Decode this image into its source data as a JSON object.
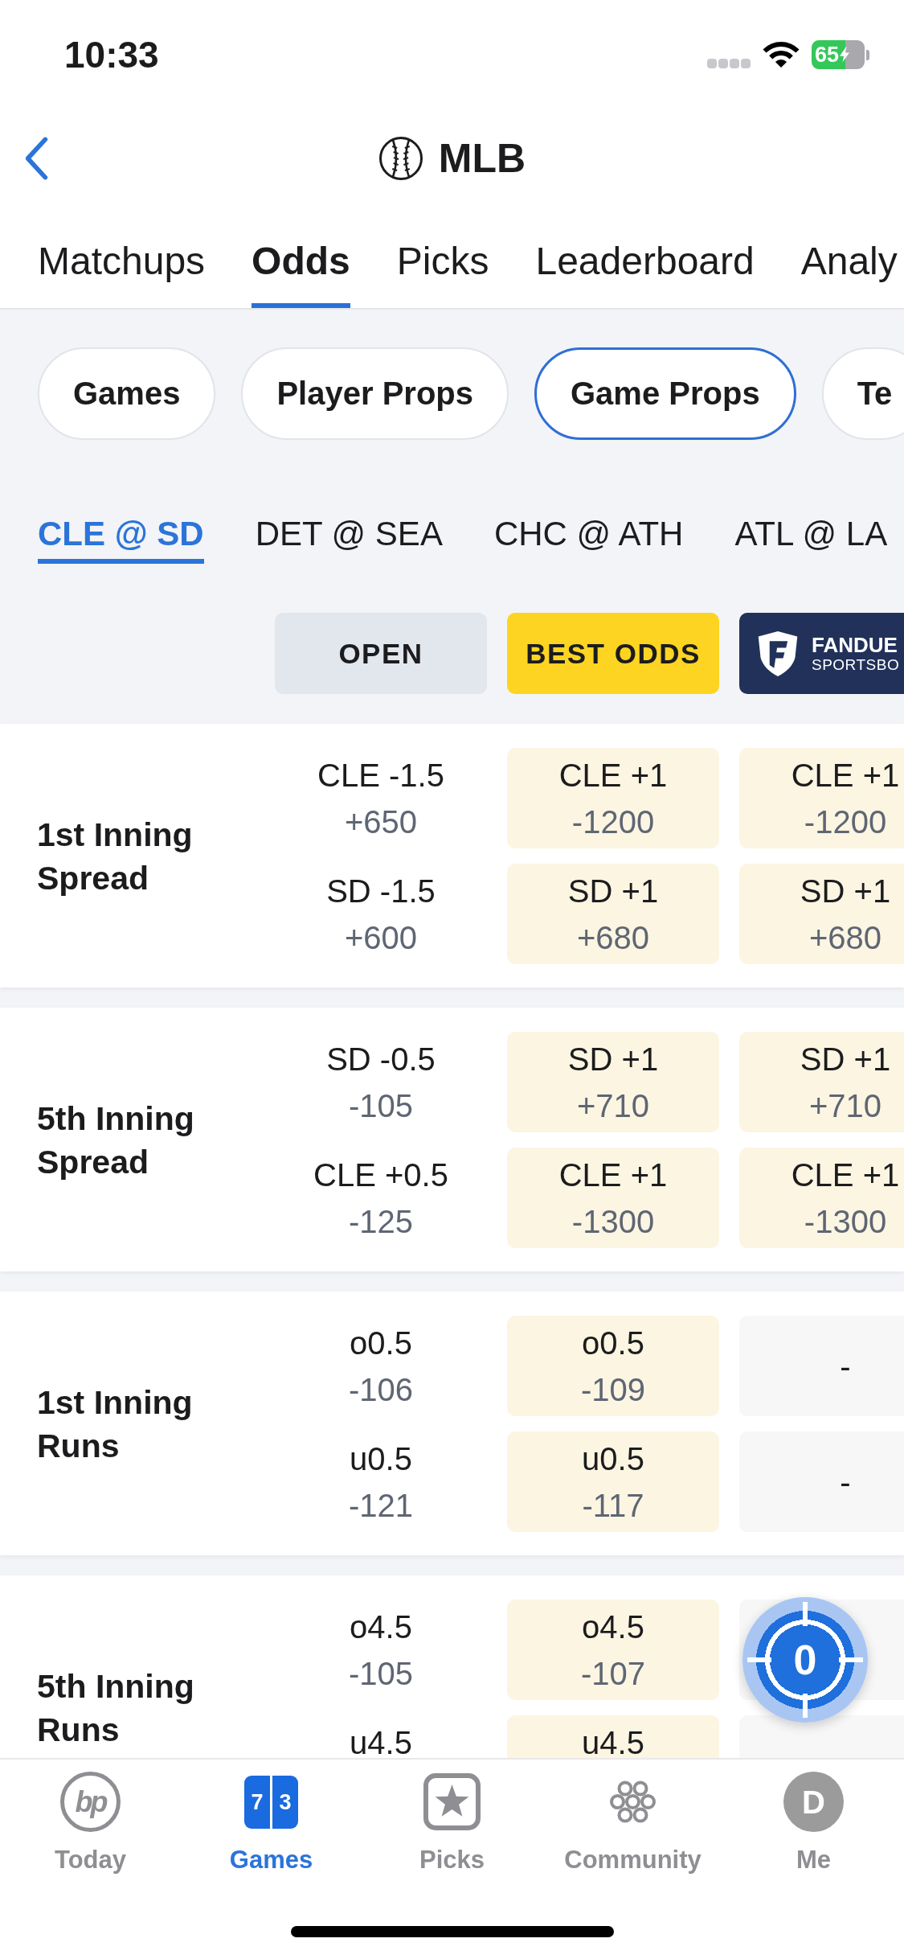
{
  "status_bar": {
    "time": "10:33",
    "battery": "65",
    "charging": true
  },
  "header": {
    "title": "MLB"
  },
  "tabs": [
    {
      "label": "Matchups",
      "selected": false
    },
    {
      "label": "Odds",
      "selected": true
    },
    {
      "label": "Picks",
      "selected": false
    },
    {
      "label": "Leaderboard",
      "selected": false
    },
    {
      "label": "Analy",
      "selected": false
    }
  ],
  "filters": [
    {
      "label": "Games",
      "selected": false
    },
    {
      "label": "Player Props",
      "selected": false
    },
    {
      "label": "Game Props",
      "selected": true
    },
    {
      "label": "Te",
      "selected": false
    }
  ],
  "games": [
    {
      "label": "CLE @ SD",
      "selected": true
    },
    {
      "label": "DET @ SEA",
      "selected": false
    },
    {
      "label": "CHC @ ATH",
      "selected": false
    },
    {
      "label": "ATL @ LA",
      "selected": false
    }
  ],
  "columns": [
    {
      "kind": "open",
      "label": "OPEN"
    },
    {
      "kind": "best",
      "label": "BEST ODDS"
    },
    {
      "kind": "book",
      "name": "FANDUE",
      "subtitle": "SPORTSBO"
    }
  ],
  "markets": [
    {
      "name": "1st Inning Spread",
      "outcomes": [
        {
          "cells": [
            {
              "kind": "open",
              "line": "CLE -1.5",
              "odds": "+650"
            },
            {
              "kind": "price",
              "line": "CLE +1",
              "odds": "-1200"
            },
            {
              "kind": "price",
              "line": "CLE +1",
              "odds": "-1200"
            }
          ]
        },
        {
          "cells": [
            {
              "kind": "open",
              "line": "SD -1.5",
              "odds": "+600"
            },
            {
              "kind": "price",
              "line": "SD +1",
              "odds": "+680"
            },
            {
              "kind": "price",
              "line": "SD +1",
              "odds": "+680"
            }
          ]
        }
      ]
    },
    {
      "name": "5th Inning Spread",
      "outcomes": [
        {
          "cells": [
            {
              "kind": "open",
              "line": "SD -0.5",
              "odds": "-105"
            },
            {
              "kind": "price",
              "line": "SD +1",
              "odds": "+710"
            },
            {
              "kind": "price",
              "line": "SD +1",
              "odds": "+710"
            }
          ]
        },
        {
          "cells": [
            {
              "kind": "open",
              "line": "CLE +0.5",
              "odds": "-125"
            },
            {
              "kind": "price",
              "line": "CLE +1",
              "odds": "-1300"
            },
            {
              "kind": "price",
              "line": "CLE +1",
              "odds": "-1300"
            }
          ]
        }
      ]
    },
    {
      "name": "1st Inning Runs",
      "outcomes": [
        {
          "cells": [
            {
              "kind": "open",
              "line": "o0.5",
              "odds": "-106"
            },
            {
              "kind": "price",
              "line": "o0.5",
              "odds": "-109"
            },
            {
              "kind": "unavailable",
              "line": "-"
            }
          ]
        },
        {
          "cells": [
            {
              "kind": "open",
              "line": "u0.5",
              "odds": "-121"
            },
            {
              "kind": "price",
              "line": "u0.5",
              "odds": "-117"
            },
            {
              "kind": "unavailable",
              "line": "-"
            }
          ]
        }
      ]
    },
    {
      "name": "5th Inning Runs",
      "outcomes": [
        {
          "cells": [
            {
              "kind": "open",
              "line": "o4.5",
              "odds": "-105"
            },
            {
              "kind": "price",
              "line": "o4.5",
              "odds": "-107"
            },
            {
              "kind": "blank"
            }
          ]
        },
        {
          "cells": [
            {
              "kind": "open",
              "line": "u4.5"
            },
            {
              "kind": "price",
              "line": "u4.5"
            },
            {
              "kind": "blank"
            }
          ]
        }
      ]
    }
  ],
  "floating_button": {
    "count": "0"
  },
  "nav": [
    {
      "kind": "logo",
      "label": "Today",
      "logo_text": "bp",
      "selected": false
    },
    {
      "kind": "score",
      "label": "Games",
      "digits": [
        "7",
        "3"
      ],
      "selected": true
    },
    {
      "kind": "star",
      "label": "Picks",
      "selected": false
    },
    {
      "kind": "cluster",
      "label": "Community",
      "selected": false
    },
    {
      "kind": "avatar",
      "label": "Me",
      "initial": "D",
      "selected": false
    }
  ]
}
